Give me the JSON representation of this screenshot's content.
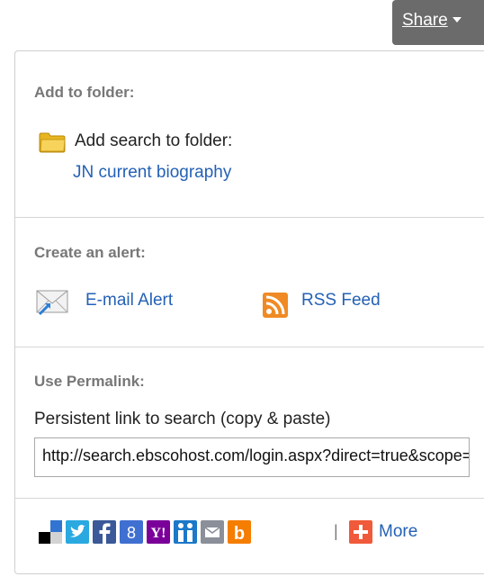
{
  "share": {
    "label": "Share",
    "colors": {
      "bg": "#6b6b6b",
      "text": "#ffffff"
    }
  },
  "folder_section": {
    "title": "Add to folder:",
    "add_search_label": "Add search to folder:",
    "folder_link": "JN current biography",
    "icon": "folder-icon"
  },
  "alert_section": {
    "title": "Create an alert:",
    "email_alert": "E-mail Alert",
    "email_icon": "email-alert-icon",
    "rss_feed": "RSS Feed",
    "rss_icon": "rss-icon"
  },
  "permalink_section": {
    "title": "Use Permalink:",
    "description": "Persistent link to search (copy & paste)",
    "url": "http://search.ebscohost.com/login.aspx?direct=true&scope=site&db=aph"
  },
  "social": {
    "items": [
      {
        "name": "delicious-icon"
      },
      {
        "name": "twitter-icon"
      },
      {
        "name": "facebook-icon"
      },
      {
        "name": "google-plus-icon"
      },
      {
        "name": "yahoo-icon"
      },
      {
        "name": "myspace-icon"
      },
      {
        "name": "email-icon"
      },
      {
        "name": "blogger-icon"
      }
    ],
    "separator": "|",
    "more_label": "More",
    "more_icon": "plus-icon"
  },
  "colors": {
    "link": "#2461b5",
    "section_title": "#777777",
    "divider": "#d6d6d6"
  }
}
